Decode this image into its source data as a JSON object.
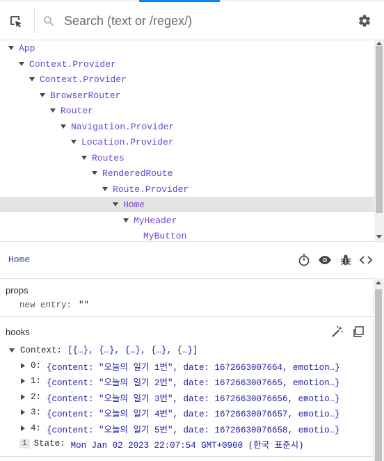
{
  "search": {
    "placeholder": "Search (text or /regex/)"
  },
  "tree": [
    {
      "label": "App"
    },
    {
      "label": "Context.Provider"
    },
    {
      "label": "Context.Provider"
    },
    {
      "label": "BrowserRouter"
    },
    {
      "label": "Router"
    },
    {
      "label": "Navigation.Provider"
    },
    {
      "label": "Location.Provider"
    },
    {
      "label": "Routes"
    },
    {
      "label": "RenderedRoute"
    },
    {
      "label": "Route.Provider"
    },
    {
      "label": "Home"
    },
    {
      "label": "MyHeader"
    },
    {
      "label": "MyButton"
    }
  ],
  "selected": {
    "name": "Home"
  },
  "props": {
    "title": "props",
    "entries": [
      {
        "key": "new entry:",
        "value": "\"\""
      }
    ]
  },
  "hooks": {
    "title": "hooks",
    "context_key": "Context:",
    "context_summary": "[{…}, {…}, {…}, {…}, {…}]",
    "items": [
      {
        "index": "0:",
        "text": "{content: \"오늘의 일기 1번\", date: 1672663007664, emotion…}"
      },
      {
        "index": "1:",
        "text": "{content: \"오늘의 일기 2번\", date: 1672663007665, emotion…}"
      },
      {
        "index": "2:",
        "text": "{content: \"오늘의 일기 3번\", date: 16726630076656, emotio…}"
      },
      {
        "index": "3:",
        "text": "{content: \"오늘의 일기 4번\", date: 16726630076657, emotio…}"
      },
      {
        "index": "4:",
        "text": "{content: \"오늘의 일기 5번\", date: 16726630076658, emotio…}"
      }
    ],
    "state_badge": "1",
    "state_key": "State:",
    "state_value": "Mon Jan 02 2023 22:07:54 GMT+0900 (한국 표준시)"
  }
}
